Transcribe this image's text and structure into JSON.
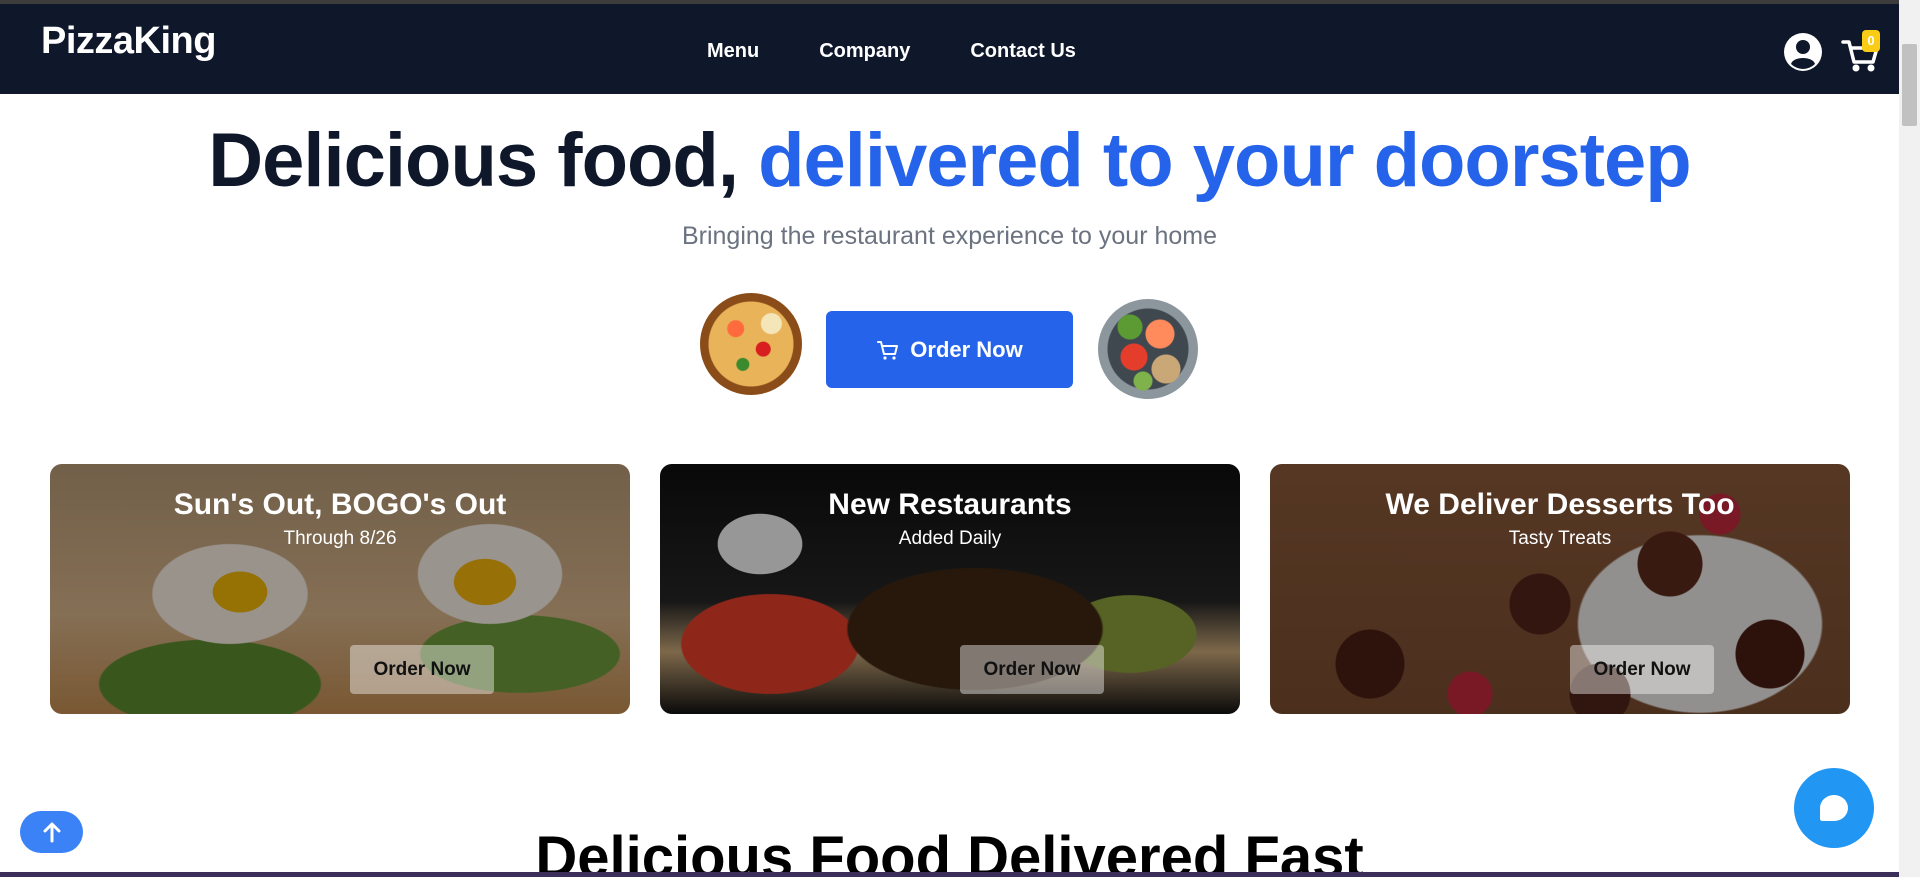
{
  "header": {
    "brand": "PizzaKing",
    "nav": [
      "Menu",
      "Company",
      "Contact Us"
    ],
    "cart_count": "0",
    "icons": {
      "user": "user-circle-icon",
      "cart": "cart-icon"
    }
  },
  "hero": {
    "title_plain": "Delicious food, ",
    "title_accent": "delivered to your doorstep",
    "subtitle": "Bringing the restaurant experience to your home",
    "cta_label": "Order Now",
    "accent_color": "#2563eb"
  },
  "promos": [
    {
      "title": "Sun's Out, BOGO's Out",
      "subtitle": "Through 8/26",
      "button": "Order Now"
    },
    {
      "title": "New Restaurants",
      "subtitle": "Added Daily",
      "button": "Order Now"
    },
    {
      "title": "We Deliver Desserts Too",
      "subtitle": "Tasty Treats",
      "button": "Order Now"
    }
  ],
  "section": {
    "heading": "Delicious Food Delivered Fast"
  },
  "colors": {
    "navbar": "#0f172a",
    "primary": "#2563eb",
    "badge": "#facc15",
    "chat": "#2196f3"
  }
}
